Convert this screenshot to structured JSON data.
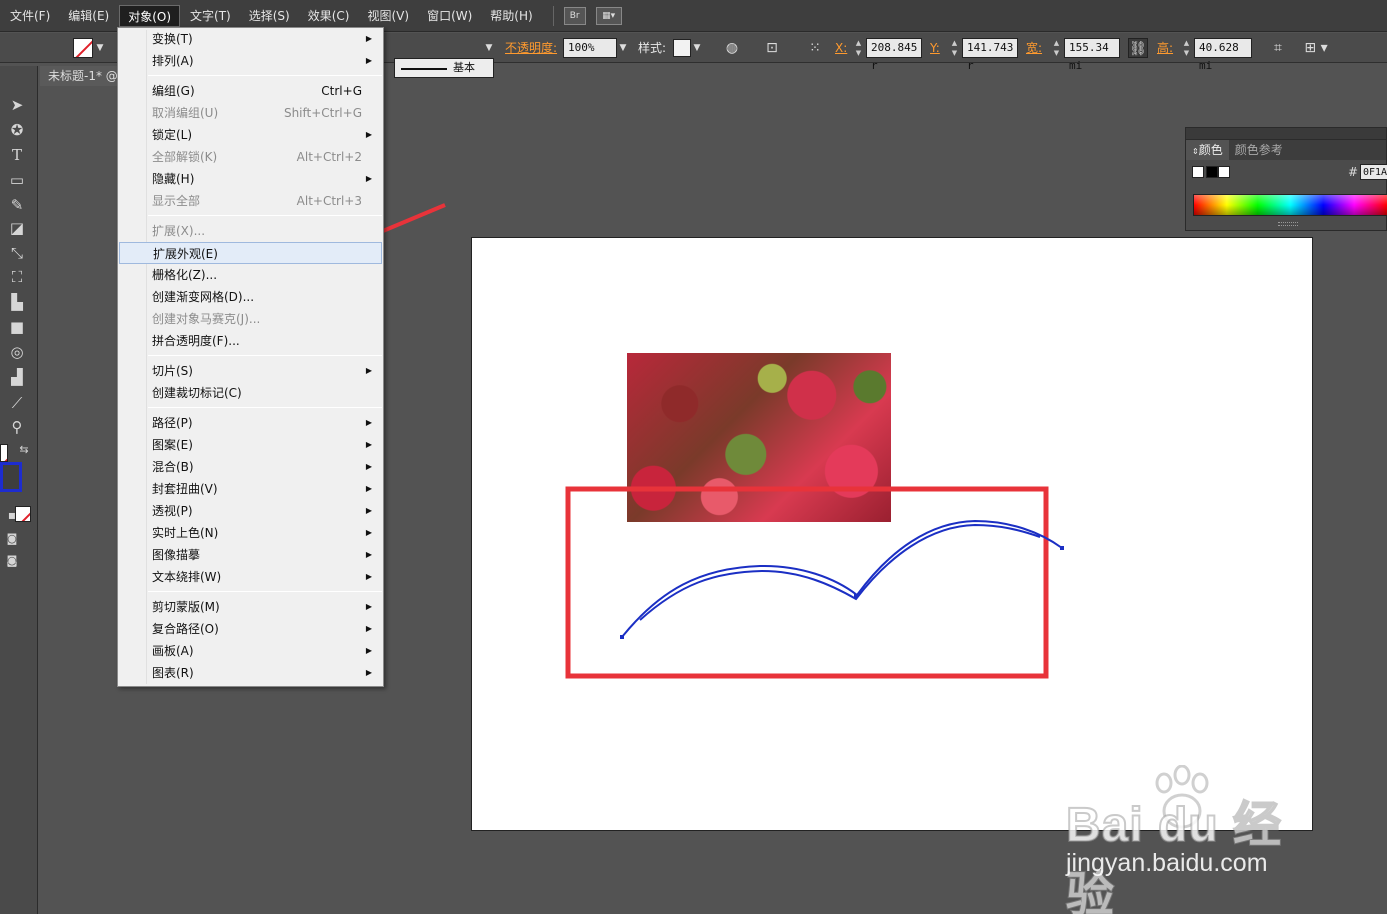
{
  "menubar": {
    "items": [
      "文件(F)",
      "编辑(E)",
      "对象(O)",
      "文字(T)",
      "选择(S)",
      "效果(C)",
      "视图(V)",
      "窗口(W)",
      "帮助(H)"
    ],
    "bridge_icon": "Br"
  },
  "control_bar": {
    "stroke_style": "基本",
    "opacity_label": "不透明度:",
    "opacity_value": "100%",
    "style_label": "样式:",
    "x_label": "X:",
    "x_value": "208.845 r",
    "y_label": "Y:",
    "y_value": "141.743 r",
    "w_label": "宽:",
    "w_value": "155.34 mi",
    "h_label": "高:",
    "h_value": "40.628 mi"
  },
  "document_tab": {
    "title": "未标题-1* @"
  },
  "color_panel": {
    "tabs": [
      "颜色",
      "颜色参考"
    ],
    "hex_label": "#",
    "hex_value": "0F1A"
  },
  "object_menu": {
    "items": [
      {
        "label": "变换(T)",
        "shortcut": "",
        "submenu": true,
        "disabled": false
      },
      {
        "label": "排列(A)",
        "shortcut": "",
        "submenu": true,
        "disabled": false
      },
      {
        "label": "编组(G)",
        "shortcut": "Ctrl+G",
        "submenu": false,
        "disabled": false
      },
      {
        "label": "取消编组(U)",
        "shortcut": "Shift+Ctrl+G",
        "submenu": false,
        "disabled": true
      },
      {
        "label": "锁定(L)",
        "shortcut": "",
        "submenu": true,
        "disabled": false
      },
      {
        "label": "全部解锁(K)",
        "shortcut": "Alt+Ctrl+2",
        "submenu": false,
        "disabled": true
      },
      {
        "label": "隐藏(H)",
        "shortcut": "",
        "submenu": true,
        "disabled": false
      },
      {
        "label": "显示全部",
        "shortcut": "Alt+Ctrl+3",
        "submenu": false,
        "disabled": true
      },
      {
        "label": "扩展(X)...",
        "shortcut": "",
        "submenu": false,
        "disabled": true
      },
      {
        "label": "扩展外观(E)",
        "shortcut": "",
        "submenu": false,
        "disabled": false,
        "highlighted": true
      },
      {
        "label": "栅格化(Z)...",
        "shortcut": "",
        "submenu": false,
        "disabled": false
      },
      {
        "label": "创建渐变网格(D)...",
        "shortcut": "",
        "submenu": false,
        "disabled": false
      },
      {
        "label": "创建对象马赛克(J)...",
        "shortcut": "",
        "submenu": false,
        "disabled": true
      },
      {
        "label": "拼合透明度(F)...",
        "shortcut": "",
        "submenu": false,
        "disabled": false
      },
      {
        "label": "切片(S)",
        "shortcut": "",
        "submenu": true,
        "disabled": false
      },
      {
        "label": "创建裁切标记(C)",
        "shortcut": "",
        "submenu": false,
        "disabled": false
      },
      {
        "label": "路径(P)",
        "shortcut": "",
        "submenu": true,
        "disabled": false
      },
      {
        "label": "图案(E)",
        "shortcut": "",
        "submenu": true,
        "disabled": false
      },
      {
        "label": "混合(B)",
        "shortcut": "",
        "submenu": true,
        "disabled": false
      },
      {
        "label": "封套扭曲(V)",
        "shortcut": "",
        "submenu": true,
        "disabled": false
      },
      {
        "label": "透视(P)",
        "shortcut": "",
        "submenu": true,
        "disabled": false
      },
      {
        "label": "实时上色(N)",
        "shortcut": "",
        "submenu": true,
        "disabled": false
      },
      {
        "label": "图像描摹",
        "shortcut": "",
        "submenu": true,
        "disabled": false
      },
      {
        "label": "文本绕排(W)",
        "shortcut": "",
        "submenu": true,
        "disabled": false
      },
      {
        "label": "剪切蒙版(M)",
        "shortcut": "",
        "submenu": true,
        "disabled": false
      },
      {
        "label": "复合路径(O)",
        "shortcut": "",
        "submenu": true,
        "disabled": false
      },
      {
        "label": "画板(A)",
        "shortcut": "",
        "submenu": true,
        "disabled": false
      },
      {
        "label": "图表(R)",
        "shortcut": "",
        "submenu": true,
        "disabled": false
      }
    ]
  },
  "watermark": {
    "logo_text": "Bai du 经验",
    "url": "jingyan.baidu.com"
  },
  "colors": {
    "annotation_red": "#e8333a",
    "path_blue": "#1b2fc4",
    "fill_swatch_blue": "#1d2ccf",
    "menu_highlight": "#e3ecf8"
  },
  "icons": {
    "toolbox": [
      "selection-arrow-icon",
      "lasso-icon",
      "type-icon",
      "rectangle-icon",
      "pencil-icon",
      "eraser-icon",
      "scale-icon",
      "free-transform-icon",
      "symbol-sprayer-icon",
      "gradient-icon",
      "shape-builder-icon",
      "graph-icon",
      "eyedropper-icon",
      "zoom-icon"
    ]
  }
}
